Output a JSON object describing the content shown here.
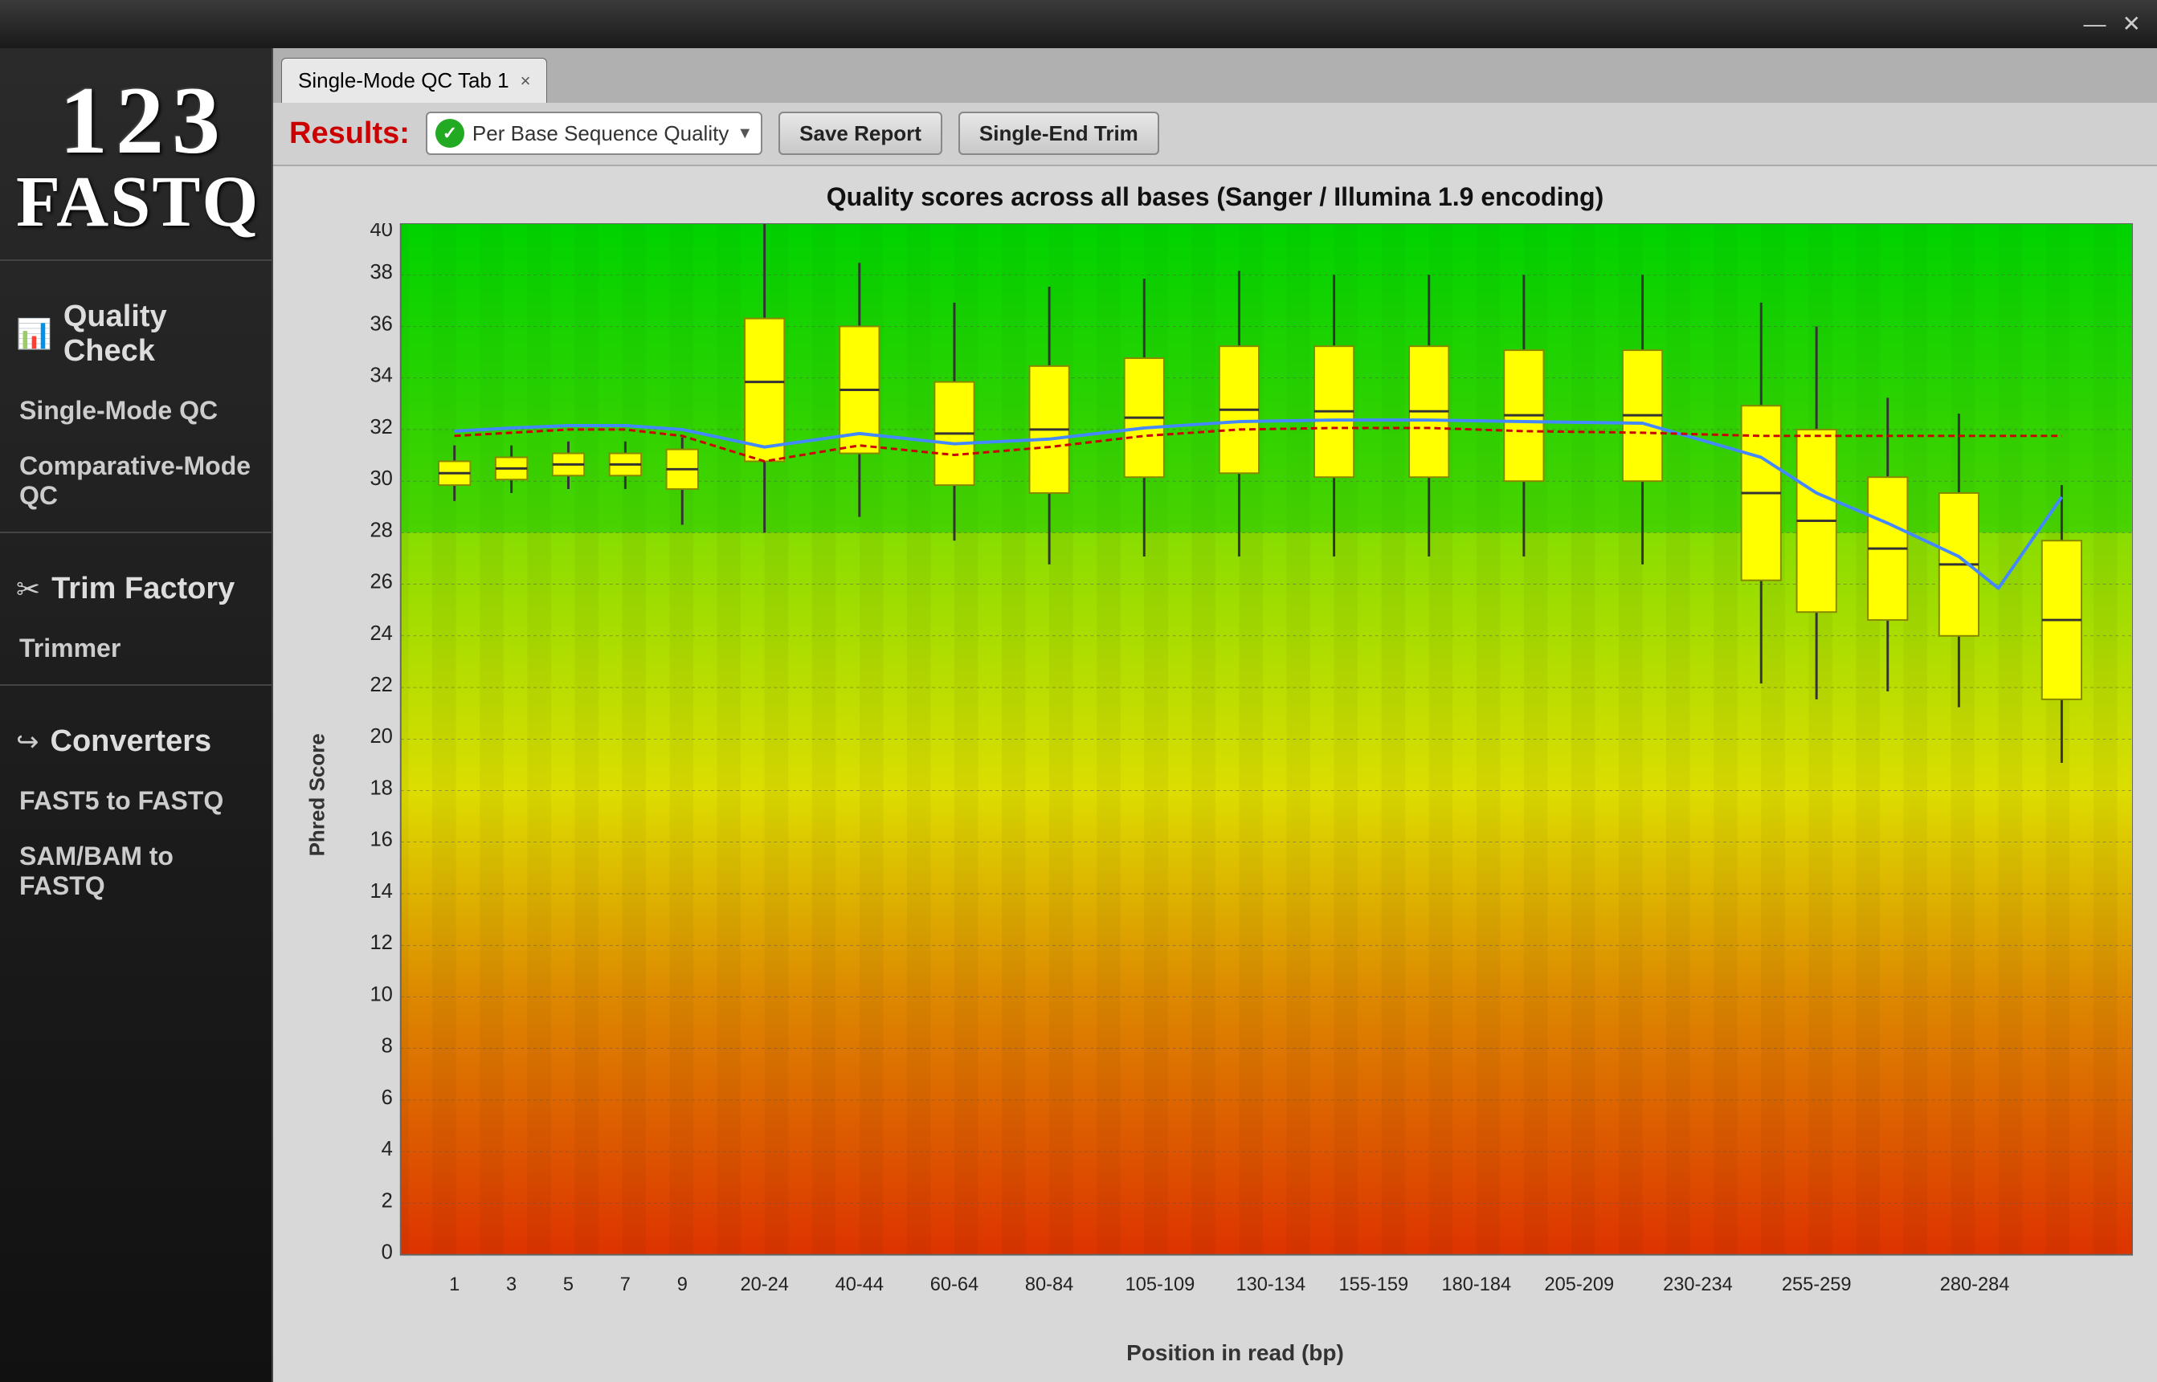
{
  "titlebar": {
    "minimize_label": "—",
    "close_label": "✕"
  },
  "logo": {
    "numbers": "1 2 3",
    "word": "FASTQ"
  },
  "sidebar": {
    "sections": [
      {
        "id": "quality-check",
        "icon": "📊",
        "label": "Quality Check",
        "items": [
          {
            "id": "single-mode-qc",
            "label": "Single-Mode QC"
          },
          {
            "id": "comparative-mode-qc",
            "label": "Comparative-Mode QC"
          }
        ]
      },
      {
        "id": "trim-factory",
        "icon": "✂",
        "label": "Trim Factory",
        "items": [
          {
            "id": "trimmer",
            "label": "Trimmer"
          }
        ]
      },
      {
        "id": "converters",
        "icon": "↩",
        "label": "Converters",
        "items": [
          {
            "id": "fast5-to-fastq",
            "label": "FAST5 to FASTQ"
          },
          {
            "id": "sam-bam-to-fastq",
            "label": "SAM/BAM to FASTQ"
          }
        ]
      }
    ]
  },
  "tab": {
    "label": "Single-Mode QC Tab 1",
    "close": "×"
  },
  "toolbar": {
    "results_label": "Results:",
    "dropdown_text": "Per Base Sequence Quality",
    "save_report_label": "Save Report",
    "single_end_trim_label": "Single-End Trim"
  },
  "chart": {
    "title": "Quality scores across all bases (Sanger / Illumina 1.9 encoding)",
    "y_axis_label": "Phred Score",
    "x_axis_label": "Position in read (bp)",
    "y_ticks": [
      0,
      2,
      4,
      6,
      8,
      10,
      12,
      14,
      16,
      18,
      20,
      22,
      24,
      26,
      28,
      30,
      32,
      34,
      36,
      38,
      40
    ],
    "x_labels": [
      "1",
      "3",
      "5",
      "7",
      "9",
      "20-24",
      "40-44",
      "60-64",
      "80-84",
      "105-109",
      "130-134",
      "155-159",
      "180-184",
      "205-209",
      "230-234",
      "255-259",
      "280-284"
    ],
    "colors": {
      "green_zone": "#00cc00",
      "yellow_zone": "#cccc00",
      "red_zone": "#cc4400",
      "box_fill": "#ffff00",
      "box_stroke": "#aa8800",
      "whisker": "#333333",
      "line_blue": "#4488ff",
      "line_red": "#cc0000"
    }
  }
}
